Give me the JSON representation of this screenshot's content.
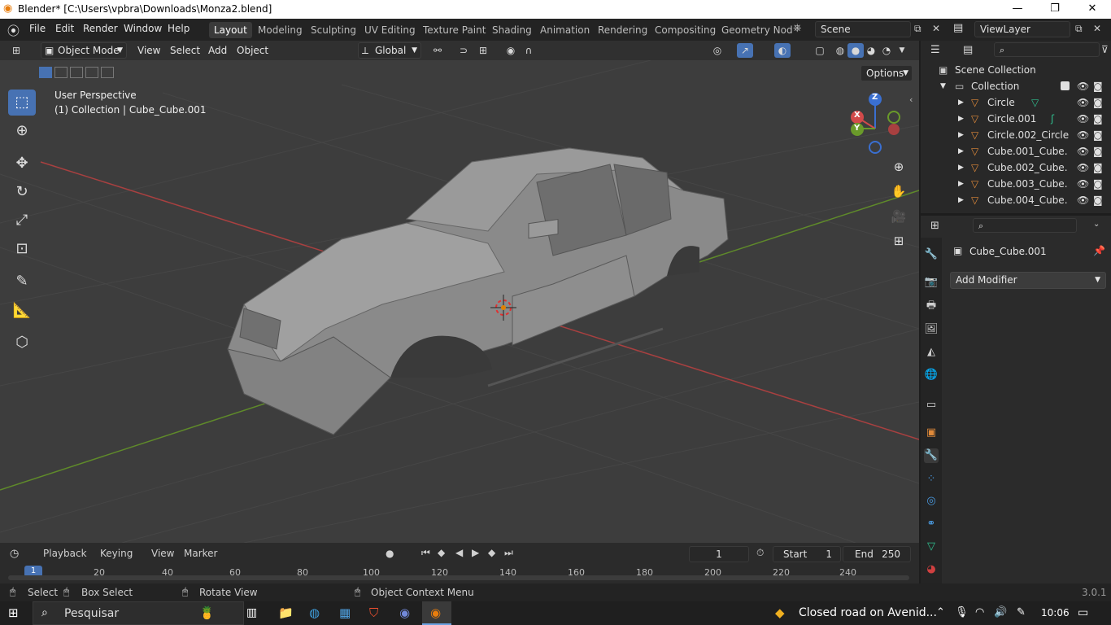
{
  "window": {
    "title": "Blender* [C:\\Users\\vpbra\\Downloads\\Monza2.blend]",
    "minimize": "—",
    "maximize": "❐",
    "close": "✕"
  },
  "topmenu": {
    "items": [
      "File",
      "Edit",
      "Render",
      "Window",
      "Help"
    ]
  },
  "workspaces": [
    "Layout",
    "Modeling",
    "Sculpting",
    "UV Editing",
    "Texture Paint",
    "Shading",
    "Animation",
    "Rendering",
    "Compositing",
    "Geometry Nod"
  ],
  "scene": {
    "name": "Scene",
    "viewlayer": "ViewLayer"
  },
  "viewport_header": {
    "mode": "Object Mode",
    "menus": [
      "View",
      "Select",
      "Add",
      "Object"
    ],
    "orientation": "Global",
    "options": "Options"
  },
  "viewport": {
    "perspective": "User Perspective",
    "collection_info": "(1) Collection | Cube_Cube.001",
    "axes": {
      "x": "X",
      "y": "Y",
      "z": "Z"
    }
  },
  "outliner": {
    "scene_collection": "Scene Collection",
    "collection": "Collection",
    "objects": [
      "Circle",
      "Circle.001",
      "Circle.002_Circle",
      "Cube.001_Cube.",
      "Cube.002_Cube.",
      "Cube.003_Cube.",
      "Cube.004_Cube."
    ]
  },
  "properties": {
    "object_name": "Cube_Cube.001",
    "add_modifier": "Add Modifier"
  },
  "timeline": {
    "menus": [
      "Playback",
      "Keying",
      "View",
      "Marker"
    ],
    "current_frame": "1",
    "start_label": "Start",
    "start": "1",
    "end_label": "End",
    "end": "250",
    "ticks": [
      "1",
      "20",
      "40",
      "60",
      "80",
      "100",
      "120",
      "140",
      "160",
      "180",
      "200",
      "220",
      "240"
    ]
  },
  "statusbar": {
    "select": "Select",
    "box_select": "Box Select",
    "rotate_view": "Rotate View",
    "context_menu": "Object Context Menu",
    "version": "3.0.1"
  },
  "taskbar": {
    "search": "Pesquisar",
    "notification": "Closed road on Avenid...",
    "time": "10:06"
  },
  "colors": {
    "accent": "#4772b3",
    "x_axis": "#d24a4a",
    "y_axis": "#6a9a2a",
    "z_axis": "#3a6fd0"
  }
}
